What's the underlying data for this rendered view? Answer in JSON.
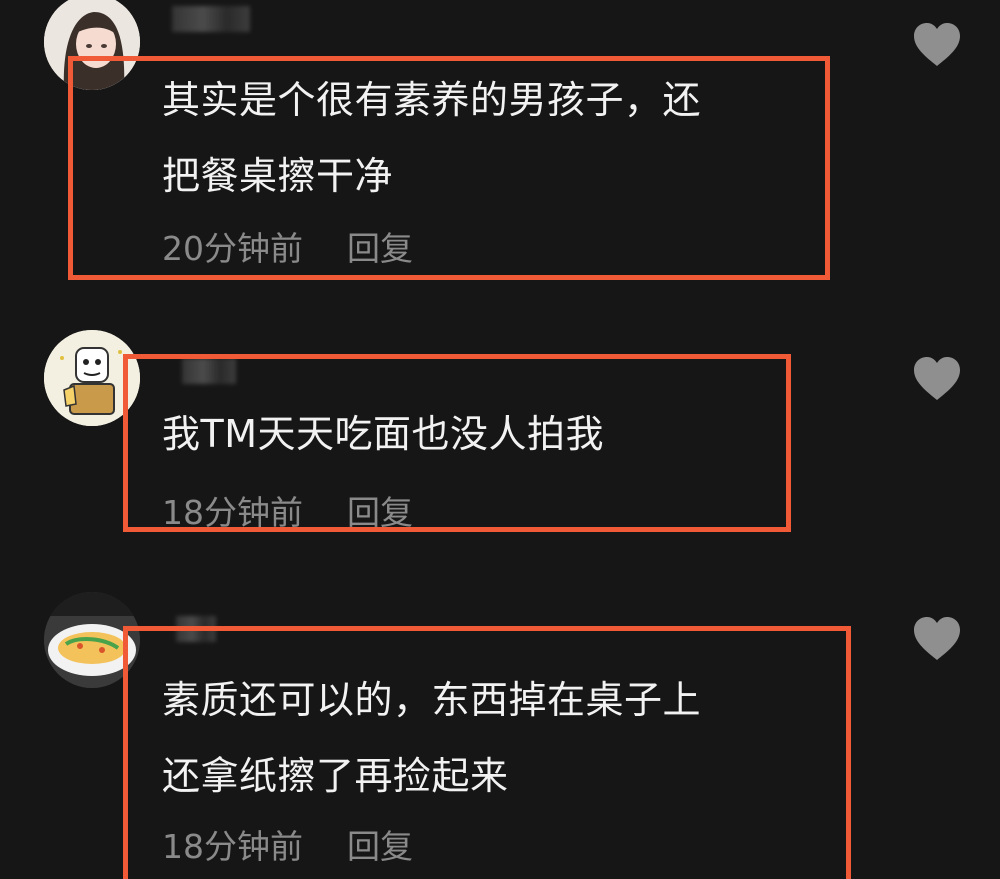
{
  "comments": [
    {
      "text": "其实是个很有素养的男孩子，还\n把餐桌擦干净",
      "time": "20分钟前",
      "reply_label": "回复",
      "like_icon": "heart-icon",
      "avatar": "avatar-girl-illustration"
    },
    {
      "text": "我TM天天吃面也没人拍我",
      "time": "18分钟前",
      "reply_label": "回复",
      "like_icon": "heart-icon",
      "avatar": "avatar-meme-face"
    },
    {
      "text": "素质还可以的，东西掉在桌子上\n还拿纸擦了再捡起来",
      "time": "18分钟前",
      "reply_label": "回复",
      "like_icon": "heart-icon",
      "avatar": "avatar-food-dish"
    }
  ],
  "colors": {
    "background": "#161616",
    "highlight_border": "#f05a37",
    "meta_text": "#8a8a8a",
    "heart": "#8f8f8f"
  }
}
